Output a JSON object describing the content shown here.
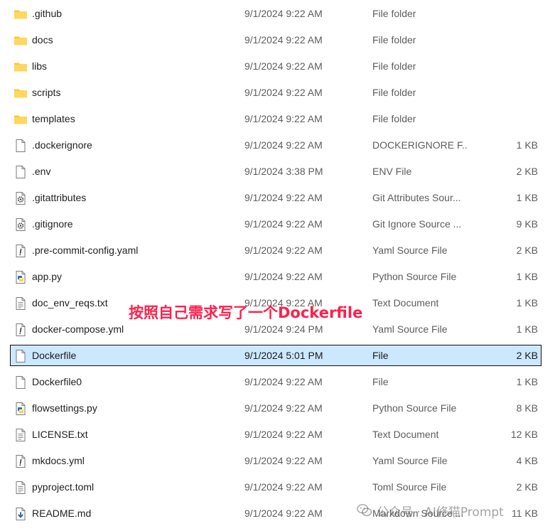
{
  "files": [
    {
      "name": ".github",
      "date": "9/1/2024 9:22 AM",
      "type": "File folder",
      "size": "",
      "icon": "folder-icon"
    },
    {
      "name": "docs",
      "date": "9/1/2024 9:22 AM",
      "type": "File folder",
      "size": "",
      "icon": "folder-icon"
    },
    {
      "name": "libs",
      "date": "9/1/2024 9:22 AM",
      "type": "File folder",
      "size": "",
      "icon": "folder-icon"
    },
    {
      "name": "scripts",
      "date": "9/1/2024 9:22 AM",
      "type": "File folder",
      "size": "",
      "icon": "folder-icon"
    },
    {
      "name": "templates",
      "date": "9/1/2024 9:22 AM",
      "type": "File folder",
      "size": "",
      "icon": "folder-icon"
    },
    {
      "name": ".dockerignore",
      "date": "9/1/2024 9:22 AM",
      "type": "DOCKERIGNORE F...",
      "size": "1 KB",
      "icon": "blank-file-icon"
    },
    {
      "name": ".env",
      "date": "9/1/2024 3:38 PM",
      "type": "ENV File",
      "size": "2 KB",
      "icon": "blank-file-icon"
    },
    {
      "name": ".gitattributes",
      "date": "9/1/2024 9:22 AM",
      "type": "Git Attributes Sour...",
      "size": "1 KB",
      "icon": "gear-file-icon"
    },
    {
      "name": ".gitignore",
      "date": "9/1/2024 9:22 AM",
      "type": "Git Ignore Source ...",
      "size": "9 KB",
      "icon": "gear-file-icon"
    },
    {
      "name": ".pre-commit-config.yaml",
      "date": "9/1/2024 9:22 AM",
      "type": "Yaml Source File",
      "size": "2 KB",
      "icon": "exclamation-file-icon"
    },
    {
      "name": "app.py",
      "date": "9/1/2024 9:22 AM",
      "type": "Python Source File",
      "size": "1 KB",
      "icon": "python-file-icon"
    },
    {
      "name": "doc_env_reqs.txt",
      "date": "9/1/2024 9:22 AM",
      "type": "Text Document",
      "size": "1 KB",
      "icon": "text-file-icon"
    },
    {
      "name": "docker-compose.yml",
      "date": "9/1/2024 9:24 PM",
      "type": "Yaml Source File",
      "size": "1 KB",
      "icon": "exclamation-file-icon"
    },
    {
      "name": "Dockerfile",
      "date": "9/1/2024 5:01 PM",
      "type": "File",
      "size": "2 KB",
      "icon": "blank-file-icon",
      "selected": true
    },
    {
      "name": "Dockerfile0",
      "date": "9/1/2024 9:22 AM",
      "type": "File",
      "size": "1 KB",
      "icon": "blank-file-icon"
    },
    {
      "name": "flowsettings.py",
      "date": "9/1/2024 9:22 AM",
      "type": "Python Source File",
      "size": "8 KB",
      "icon": "python-file-icon"
    },
    {
      "name": "LICENSE.txt",
      "date": "9/1/2024 9:22 AM",
      "type": "Text Document",
      "size": "12 KB",
      "icon": "text-file-icon"
    },
    {
      "name": "mkdocs.yml",
      "date": "9/1/2024 9:22 AM",
      "type": "Yaml Source File",
      "size": "4 KB",
      "icon": "exclamation-file-icon"
    },
    {
      "name": "pyproject.toml",
      "date": "9/1/2024 9:22 AM",
      "type": "Toml Source File",
      "size": "2 KB",
      "icon": "text-file-icon"
    },
    {
      "name": "README.md",
      "date": "9/1/2024 9:22 AM",
      "type": "Markdown Source ...",
      "size": "11 KB",
      "icon": "markdown-file-icon"
    }
  ],
  "annotation": {
    "text": "按照自己需求写了一个Dockerfile",
    "color": "#ff1f4b"
  },
  "watermark": {
    "text": "公众号 · AI修猫Prompt",
    "icon": "wechat-icon"
  },
  "colors": {
    "selection_bg": "#cce8ff",
    "folder": "#f8c93e",
    "python_blue": "#3673a5",
    "python_yellow": "#ffd43b"
  }
}
